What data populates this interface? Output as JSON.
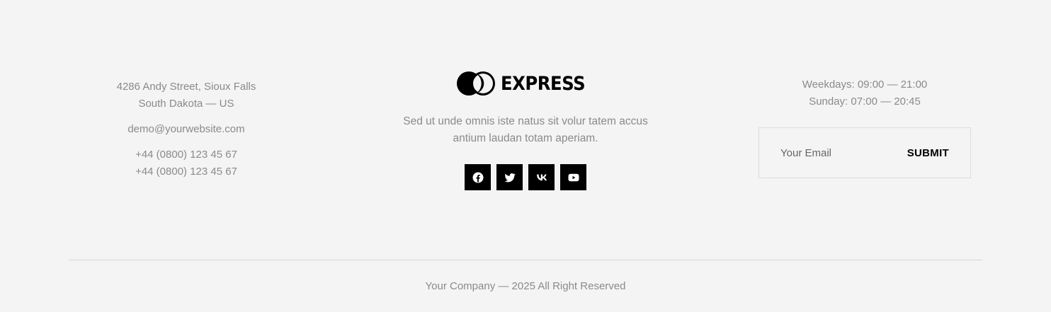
{
  "contact": {
    "address_line1": "4286 Andy Street, Sioux Falls",
    "address_line2": "South Dakota — US",
    "email": "demo@yourwebsite.com",
    "phone1": "+44 (0800) 123 45 67",
    "phone2": "+44 (0800) 123 45 67"
  },
  "brand": {
    "name": "EXPRESS",
    "tagline_line1": "Sed ut unde omnis iste natus sit volur tatem accus",
    "tagline_line2": "antium laudan totam aperiam."
  },
  "socials": [
    {
      "icon": "facebook-icon"
    },
    {
      "icon": "twitter-icon"
    },
    {
      "icon": "vk-icon"
    },
    {
      "icon": "youtube-icon"
    }
  ],
  "hours": {
    "weekdays": "Weekdays: 09:00 — 21:00",
    "sunday": "Sunday: 07:00 — 20:45"
  },
  "subscribe": {
    "placeholder": "Your Email",
    "value": "",
    "submit_label": "SUBMIT"
  },
  "copyright": "Your Company — 2025 All Right Reserved",
  "colors": {
    "background": "#f4f4f4",
    "text": "#8a8a8a",
    "accent": "#000000"
  }
}
